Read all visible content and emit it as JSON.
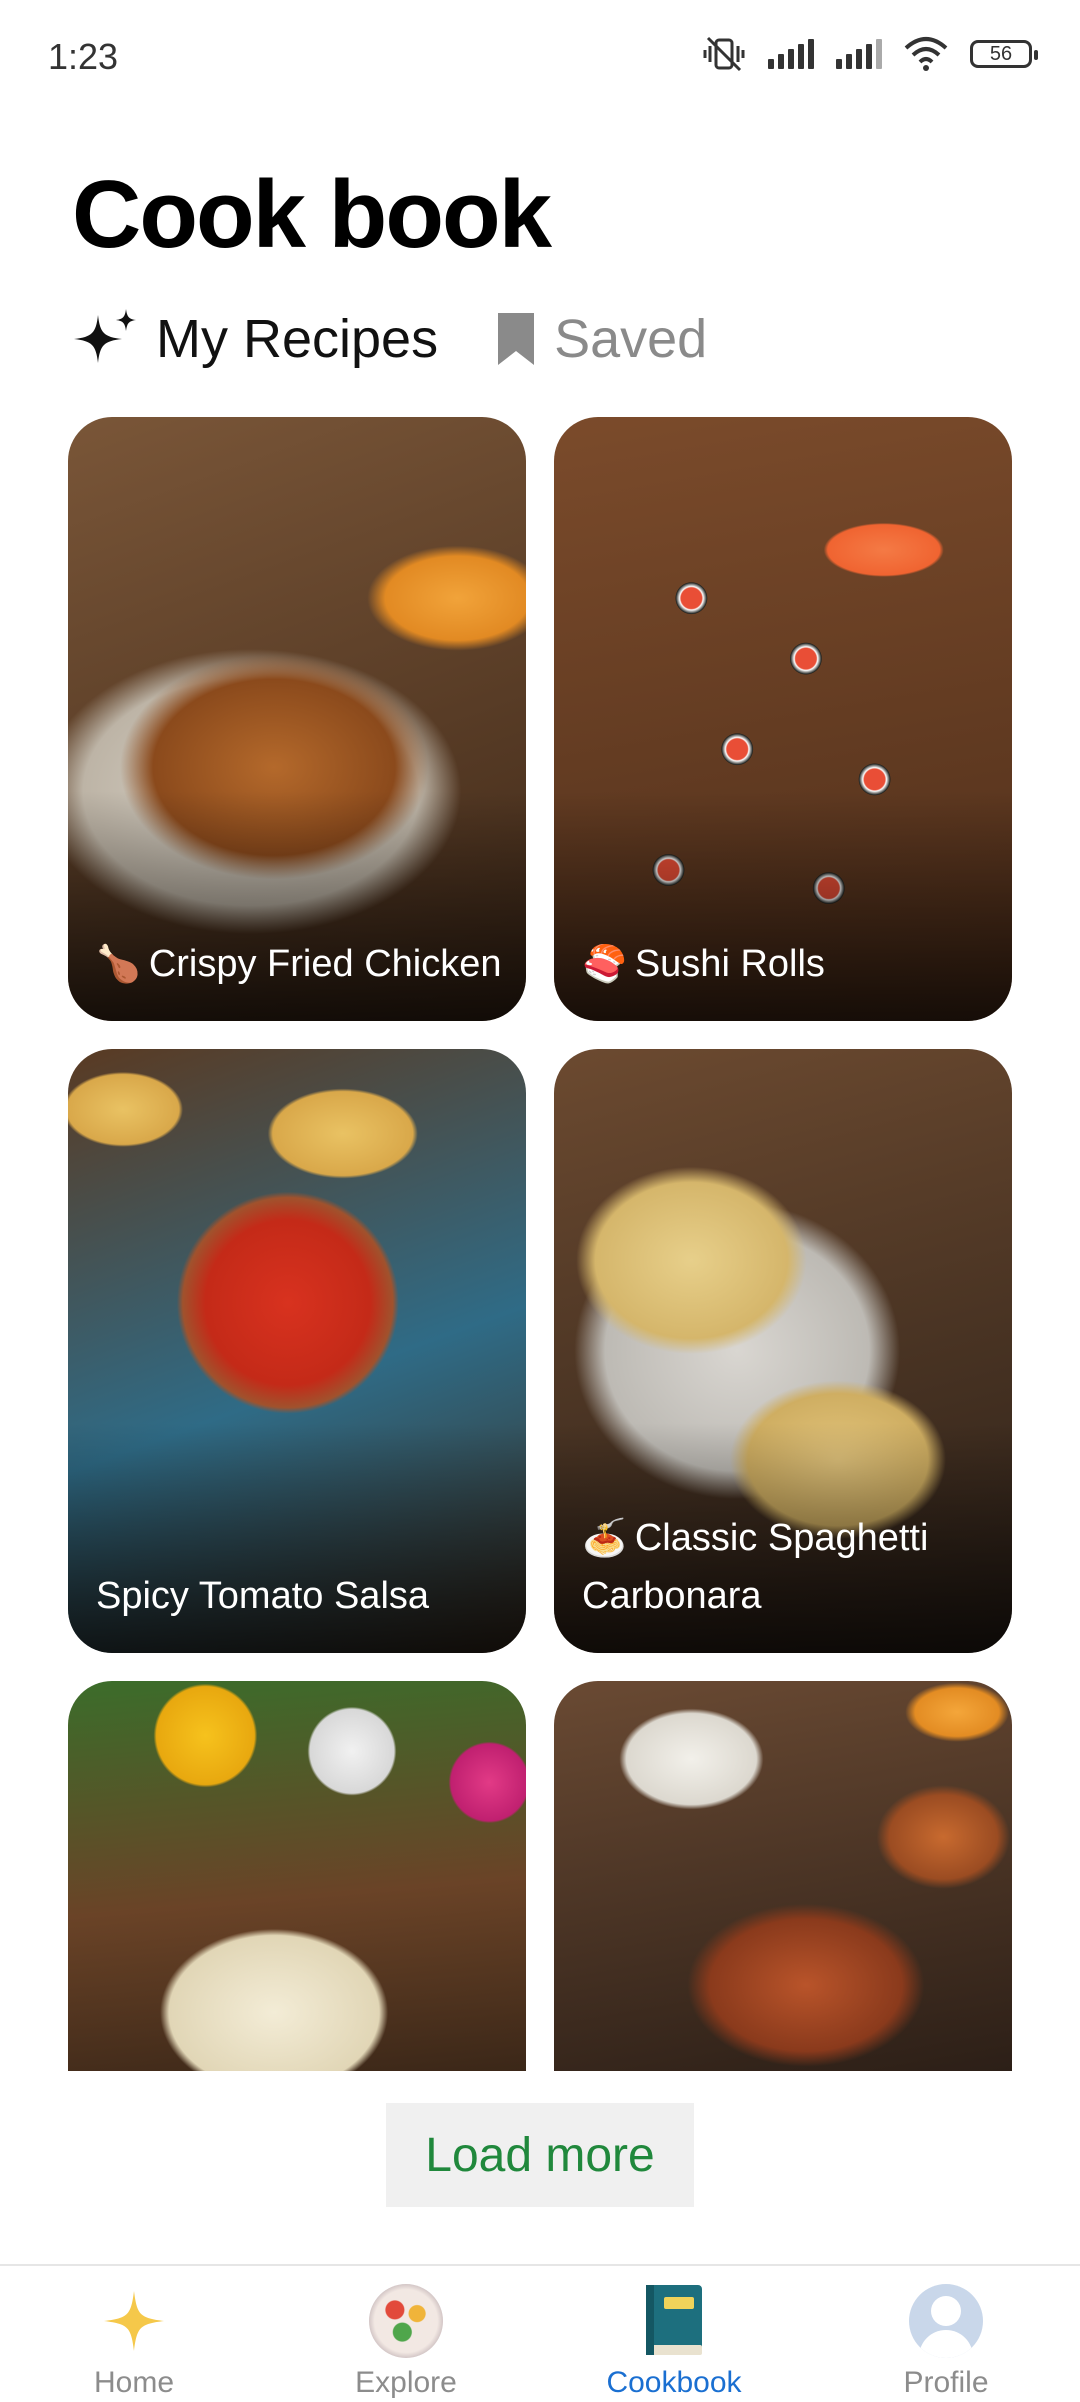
{
  "status_bar": {
    "time": "1:23",
    "battery": "56"
  },
  "header": {
    "title": "Cook book"
  },
  "tabs": [
    {
      "label": "My Recipes",
      "icon": "sparkle-icon",
      "active": true
    },
    {
      "label": "Saved",
      "icon": "bookmark-icon",
      "active": false
    }
  ],
  "recipes": [
    {
      "emoji": "🍗",
      "title": "Crispy Fried Chicken"
    },
    {
      "emoji": "🍣",
      "title": "Sushi Rolls"
    },
    {
      "emoji": "",
      "title": "Spicy Tomato Salsa"
    },
    {
      "emoji": "🍝",
      "title": "Classic Spaghetti Carbonara"
    },
    {
      "emoji": "",
      "title": ""
    },
    {
      "emoji": "",
      "title": ""
    }
  ],
  "load_more": {
    "label": "Load more"
  },
  "colors": {
    "accent_green": "#20883c",
    "active_blue": "#1a6fd1",
    "sparkle_yellow": "#f5c84a"
  },
  "bottom_nav": [
    {
      "label": "Home",
      "icon": "sparkle-icon",
      "active": false
    },
    {
      "label": "Explore",
      "icon": "food-thumbnail-icon",
      "active": false
    },
    {
      "label": "Cookbook",
      "icon": "book-icon",
      "active": true
    },
    {
      "label": "Profile",
      "icon": "avatar-icon",
      "active": false
    }
  ]
}
